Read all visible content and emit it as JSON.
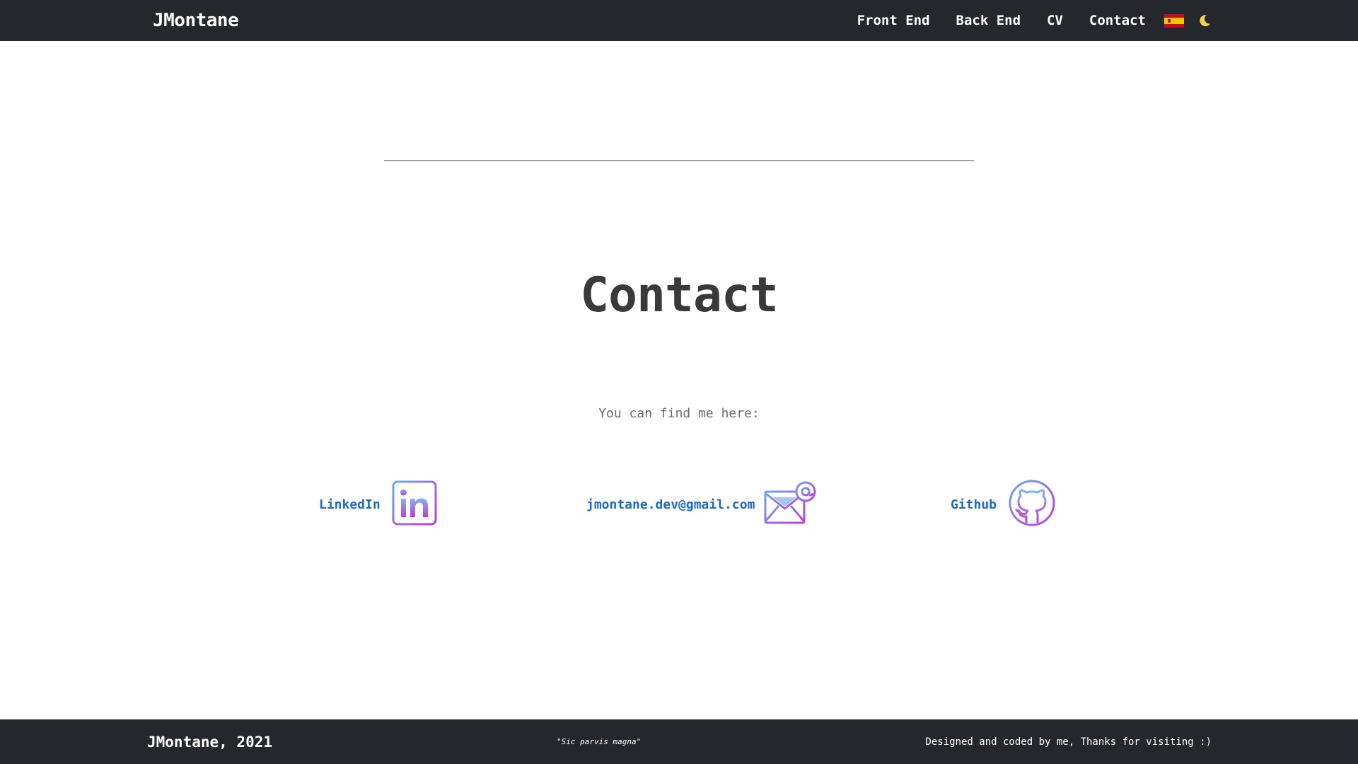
{
  "navbar": {
    "brand": "JMontane",
    "links": [
      {
        "label": "Front End"
      },
      {
        "label": "Back End"
      },
      {
        "label": "CV"
      },
      {
        "label": "Contact"
      }
    ],
    "language_icon": "spain-flag-icon",
    "theme_icon": "moon-icon",
    "theme_icon_color": "#f5d547"
  },
  "main": {
    "title": "Contact",
    "subtitle": "You can find me here:",
    "contacts": [
      {
        "label": "LinkedIn",
        "icon": "linkedin-icon"
      },
      {
        "label": "jmontane.dev@gmail.com",
        "icon": "email-icon"
      },
      {
        "label": "Github",
        "icon": "github-icon"
      }
    ],
    "link_color": "#1a6bd1",
    "icon_gradient": [
      "#6aa8f0",
      "#c13be0"
    ]
  },
  "footer": {
    "left": "JMontane, 2021",
    "quote": "\"Sic parvis magna\"",
    "right": "Designed and coded by me, Thanks for visiting :)"
  }
}
